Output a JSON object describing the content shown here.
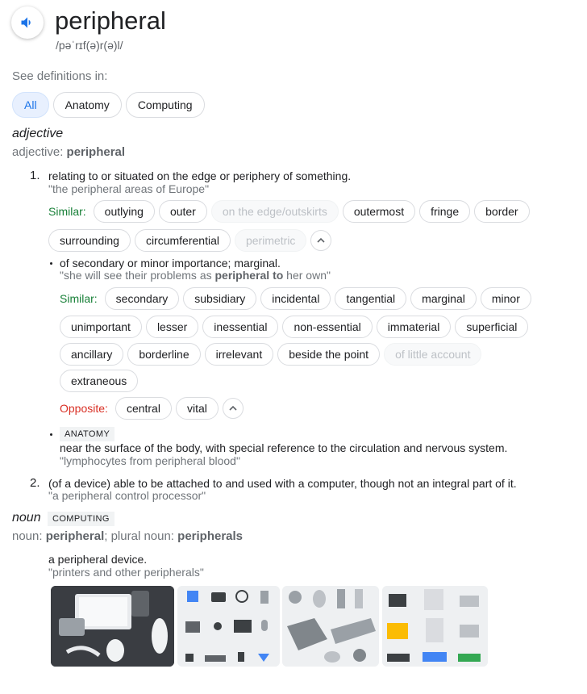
{
  "header": {
    "word": "peripheral",
    "pronunciation": "/pəˈrɪf(ə)r(ə)l/",
    "speaker_icon": "speaker-icon"
  },
  "see_definitions": {
    "label": "See definitions in:",
    "filters": [
      "All",
      "Anatomy",
      "Computing"
    ],
    "selected": "All"
  },
  "adjective": {
    "pos": "adjective",
    "pos_label": "adjective: ",
    "pos_word": "peripheral",
    "sense1": {
      "number": "1.",
      "definition": "relating to or situated on the edge or periphery of something.",
      "example": "\"the peripheral areas of Europe\"",
      "similar_label": "Similar:",
      "similar": [
        "outlying",
        "outer",
        "on the edge/outskirts",
        "outermost",
        "fringe",
        "border",
        "surrounding",
        "circumferential",
        "perimetric"
      ],
      "sub1": {
        "definition": "of secondary or minor importance; marginal.",
        "example_pre": "\"she will see their problems as ",
        "example_bold": "peripheral to",
        "example_post": " her own\"",
        "similar_label": "Similar:",
        "similar": [
          "secondary",
          "subsidiary",
          "incidental",
          "tangential",
          "marginal",
          "minor",
          "unimportant",
          "lesser",
          "inessential",
          "non-essential",
          "immaterial",
          "superficial",
          "ancillary",
          "borderline",
          "irrelevant",
          "beside the point",
          "of little account",
          "extraneous"
        ],
        "opposite_label": "Opposite:",
        "opposite": [
          "central",
          "vital"
        ]
      },
      "sub2": {
        "tag": "ANATOMY",
        "definition": "near the surface of the body, with special reference to the circulation and nervous system.",
        "example": "\"lymphocytes from peripheral blood\""
      }
    },
    "sense2": {
      "number": "2.",
      "definition": "(of a device) able to be attached to and used with a computer, though not an integral part of it.",
      "example": "\"a peripheral control processor\""
    }
  },
  "noun": {
    "pos": "noun",
    "tag": "COMPUTING",
    "pos_label": "noun: ",
    "pos_word": "peripheral",
    "plural_label": "; plural noun: ",
    "plural_word": "peripherals",
    "definition": "a peripheral device.",
    "example": "\"printers and other peripherals\""
  },
  "colors": {
    "similar": "#188038",
    "opposite": "#d93025",
    "accent": "#1a73e8"
  }
}
